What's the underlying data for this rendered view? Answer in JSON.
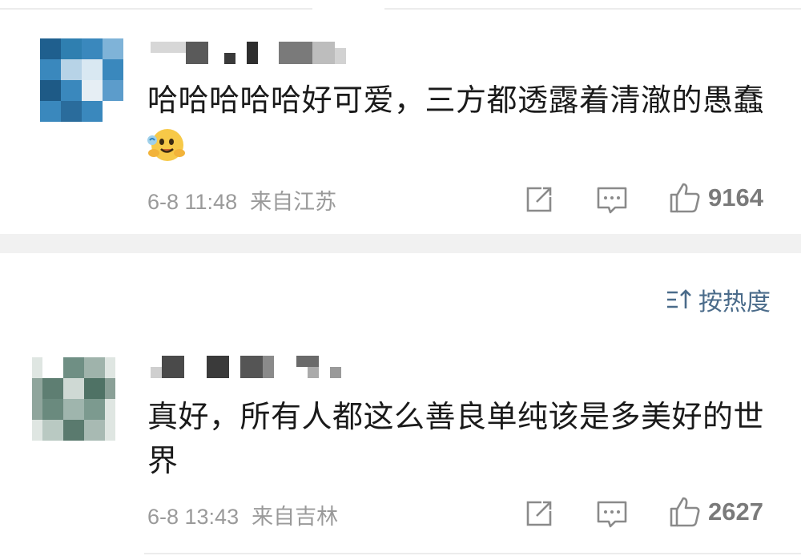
{
  "comments": [
    {
      "text": "哈哈哈哈哈好可爱，三方都透露着清澈的愚蠢",
      "emoji": "hugging-face-emoji",
      "meta": {
        "date": "6-8 11:48",
        "location": "来自江苏"
      },
      "actions": {
        "share_icon": "share-icon",
        "comment_icon": "comment-icon",
        "like_icon": "thumbs-up-icon",
        "like_count": "9164"
      }
    },
    {
      "text_line1": "真好，所有人都这么善良单纯该是多美好的世",
      "text_line2": "界",
      "meta": {
        "date": "6-8 13:43",
        "location": "来自吉林"
      },
      "actions": {
        "share_icon": "share-icon",
        "comment_icon": "comment-icon",
        "like_icon": "thumbs-up-icon",
        "like_count": "2627"
      }
    }
  ],
  "sort": {
    "icon": "sort-icon",
    "label": "按热度"
  },
  "colors": {
    "accent": "#4a6b8a",
    "meta_gray": "#9a9a9a",
    "divider": "#f1f1f1",
    "avatar1": "#2f7fb0",
    "avatar2": "#6a8a7e"
  }
}
